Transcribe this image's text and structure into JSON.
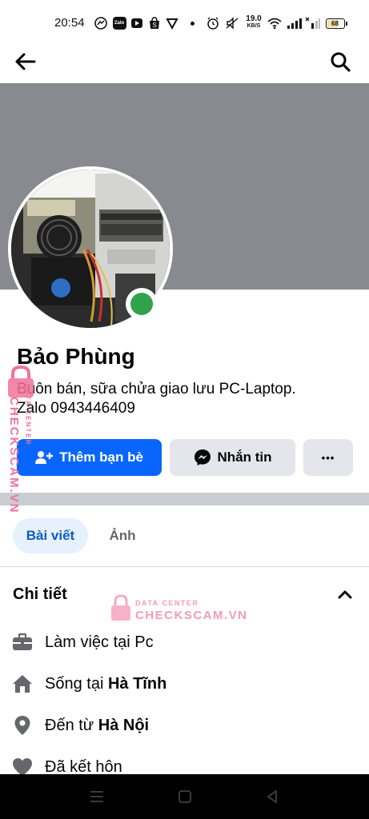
{
  "status_bar": {
    "time": "20:54",
    "app_icons": [
      "messenger-icon",
      "zalo-icon",
      "youtube-icon",
      "shopee-icon",
      "vpn-icon",
      "dot-icon"
    ],
    "zalo_text": "Zalo",
    "network_speed_value": "19.0",
    "network_speed_unit": "KB/S",
    "battery": "68"
  },
  "profile": {
    "name": "Bảo Phùng",
    "bio": "Buôn bán, sữa chửa giao lưu PC-Laptop.\nZalo 0943446409"
  },
  "actions": {
    "add_friend": "Thêm bạn bè",
    "message": "Nhắn tin",
    "more": "•••"
  },
  "tabs": [
    {
      "label": "Bài viết",
      "active": true
    },
    {
      "label": "Ảnh",
      "active": false
    }
  ],
  "details": {
    "title": "Chi tiết",
    "items": [
      {
        "icon": "briefcase-icon",
        "prefix": "Làm việc tại Pc",
        "bold": ""
      },
      {
        "icon": "home-icon",
        "prefix": "Sống tại ",
        "bold": "Hà Tĩnh"
      },
      {
        "icon": "location-pin-icon",
        "prefix": "Đến từ ",
        "bold": "Hà Nội"
      },
      {
        "icon": "heart-icon",
        "prefix": "Đã kết hôn",
        "bold": ""
      }
    ]
  },
  "watermark": {
    "line1": "DATA CENTER",
    "line2": "CHECKSCAM.VN"
  },
  "colors": {
    "primary": "#0866ff",
    "cover": "#898a8f",
    "online": "#31a24c",
    "tab_active_bg": "#e7f0fd",
    "watermark": "#f0729a"
  }
}
